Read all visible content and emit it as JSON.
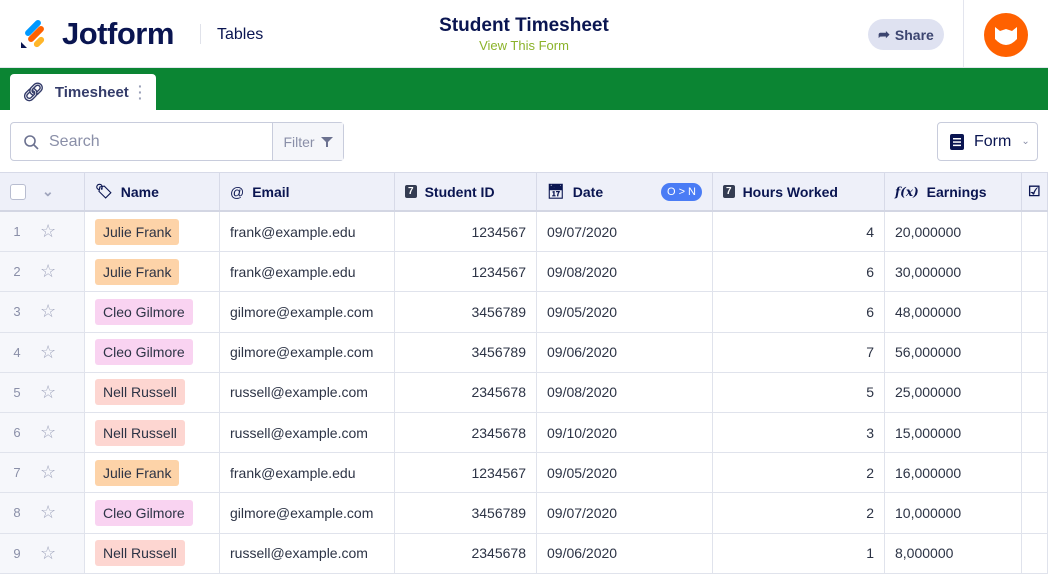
{
  "header": {
    "logo": "Jotform",
    "section": "Tables",
    "title": "Student Timesheet",
    "subtitle": "View This Form",
    "share_label": "Share"
  },
  "tab": {
    "label": "Timesheet"
  },
  "toolbar": {
    "search_placeholder": "Search",
    "filter_label": "Filter",
    "form_label": "Form"
  },
  "columns": [
    "Name",
    "Email",
    "Student ID",
    "Date",
    "Hours Worked",
    "Earnings"
  ],
  "sort_badge": "O > N",
  "colors": {
    "brand_green": "#0b8533",
    "julie": "#fdd3a8",
    "cleo": "#f9d3f1",
    "nell": "#fdd6d1"
  },
  "rows": [
    {
      "n": "1",
      "name": "Julie Frank",
      "email": "frank@example.edu",
      "id": "1234567",
      "date": "09/07/2020",
      "hours": "4",
      "earnings": "20,000000"
    },
    {
      "n": "2",
      "name": "Julie Frank",
      "email": "frank@example.edu",
      "id": "1234567",
      "date": "09/08/2020",
      "hours": "6",
      "earnings": "30,000000"
    },
    {
      "n": "3",
      "name": "Cleo Gilmore",
      "email": "gilmore@example.com",
      "id": "3456789",
      "date": "09/05/2020",
      "hours": "6",
      "earnings": "48,000000"
    },
    {
      "n": "4",
      "name": "Cleo Gilmore",
      "email": "gilmore@example.com",
      "id": "3456789",
      "date": "09/06/2020",
      "hours": "7",
      "earnings": "56,000000"
    },
    {
      "n": "5",
      "name": "Nell Russell",
      "email": "russell@example.com",
      "id": "2345678",
      "date": "09/08/2020",
      "hours": "5",
      "earnings": "25,000000"
    },
    {
      "n": "6",
      "name": "Nell Russell",
      "email": "russell@example.com",
      "id": "2345678",
      "date": "09/10/2020",
      "hours": "3",
      "earnings": "15,000000"
    },
    {
      "n": "7",
      "name": "Julie Frank",
      "email": "frank@example.edu",
      "id": "1234567",
      "date": "09/05/2020",
      "hours": "2",
      "earnings": "16,000000"
    },
    {
      "n": "8",
      "name": "Cleo Gilmore",
      "email": "gilmore@example.com",
      "id": "3456789",
      "date": "09/07/2020",
      "hours": "2",
      "earnings": "10,000000"
    },
    {
      "n": "9",
      "name": "Nell Russell",
      "email": "russell@example.com",
      "id": "2345678",
      "date": "09/06/2020",
      "hours": "1",
      "earnings": "8,000000"
    }
  ]
}
